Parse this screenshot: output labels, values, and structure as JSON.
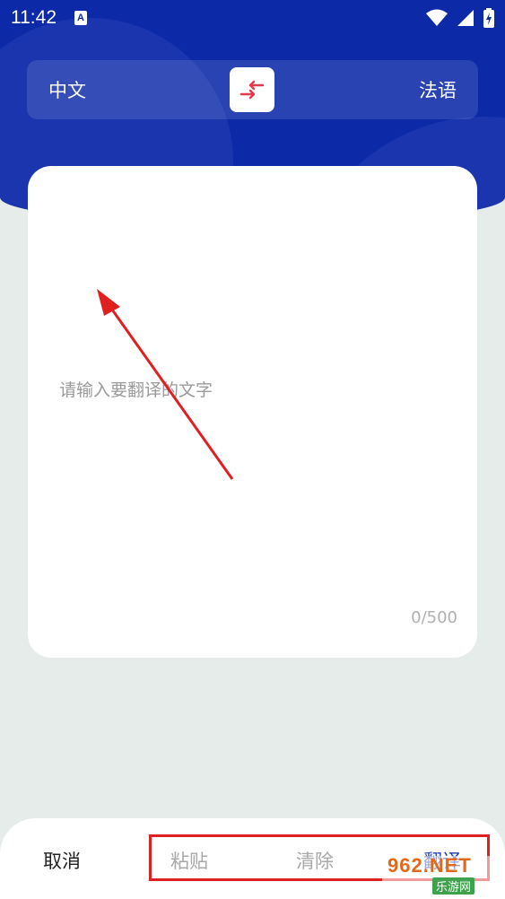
{
  "status_bar": {
    "time": "11:42",
    "notification_letter": "A"
  },
  "language": {
    "source": "中文",
    "target": "法语"
  },
  "input": {
    "placeholder": "请输入要翻译的文字",
    "counter": "0/500"
  },
  "actions": {
    "cancel": "取消",
    "paste": "粘贴",
    "clear": "清除",
    "translate": "翻译"
  },
  "watermark": {
    "main": "962.NET",
    "sub": "乐游网"
  },
  "colors": {
    "header_blue": "#0c29a8",
    "swap_icon_red": "#e23a4a",
    "annotation_red": "#e02020",
    "translate_blue": "#1d39b0"
  }
}
